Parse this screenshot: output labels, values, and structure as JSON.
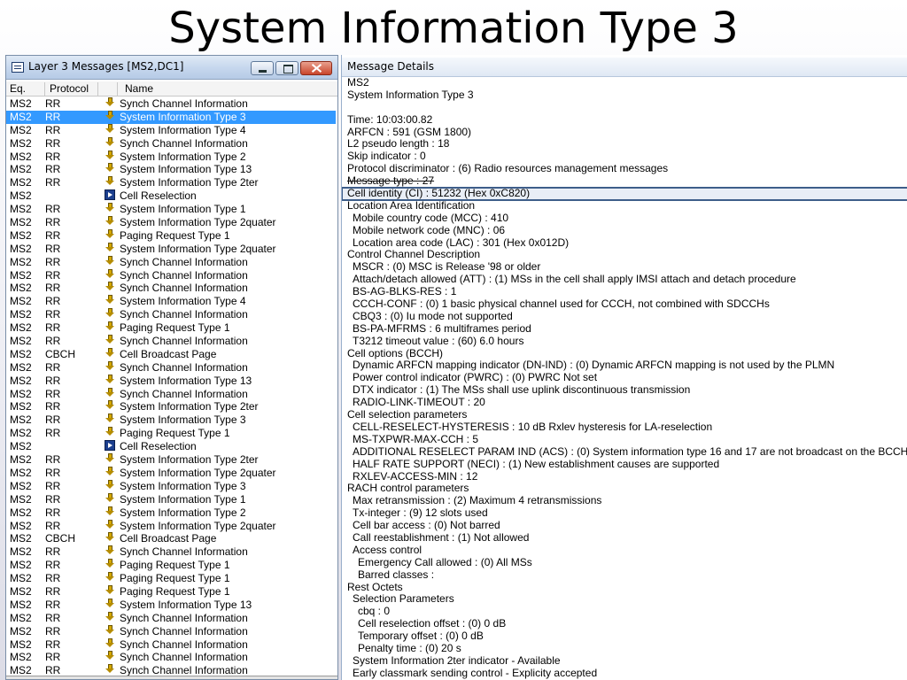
{
  "slide": {
    "title": "System Information Type 3"
  },
  "left_window": {
    "title": "Layer 3 Messages  [MS2,DC1]",
    "columns": {
      "eq": "Eq.",
      "protocol": "Protocol",
      "name": "Name"
    },
    "selected_index": 1,
    "rows": [
      {
        "eq": "MS2",
        "protocol": "RR",
        "icon": "arrow-down",
        "name": "Synch Channel Information"
      },
      {
        "eq": "MS2",
        "protocol": "RR",
        "icon": "arrow-down",
        "name": "System Information Type 3"
      },
      {
        "eq": "MS2",
        "protocol": "RR",
        "icon": "arrow-down",
        "name": "System Information Type 4"
      },
      {
        "eq": "MS2",
        "protocol": "RR",
        "icon": "arrow-down",
        "name": "Synch Channel Information"
      },
      {
        "eq": "MS2",
        "protocol": "RR",
        "icon": "arrow-down",
        "name": "System Information Type 2"
      },
      {
        "eq": "MS2",
        "protocol": "RR",
        "icon": "arrow-down",
        "name": "System Information Type 13"
      },
      {
        "eq": "MS2",
        "protocol": "RR",
        "icon": "arrow-down",
        "name": "System Information Type 2ter"
      },
      {
        "eq": "MS2",
        "protocol": "",
        "icon": "arrow-right",
        "name": "Cell Reselection"
      },
      {
        "eq": "MS2",
        "protocol": "RR",
        "icon": "arrow-down",
        "name": "System Information Type 1"
      },
      {
        "eq": "MS2",
        "protocol": "RR",
        "icon": "arrow-down",
        "name": "System Information Type 2quater"
      },
      {
        "eq": "MS2",
        "protocol": "RR",
        "icon": "arrow-down",
        "name": "Paging Request Type 1"
      },
      {
        "eq": "MS2",
        "protocol": "RR",
        "icon": "arrow-down",
        "name": "System Information Type 2quater"
      },
      {
        "eq": "MS2",
        "protocol": "RR",
        "icon": "arrow-down",
        "name": "Synch Channel Information"
      },
      {
        "eq": "MS2",
        "protocol": "RR",
        "icon": "arrow-down",
        "name": "Synch Channel Information"
      },
      {
        "eq": "MS2",
        "protocol": "RR",
        "icon": "arrow-down",
        "name": "Synch Channel Information"
      },
      {
        "eq": "MS2",
        "protocol": "RR",
        "icon": "arrow-down",
        "name": "System Information Type 4"
      },
      {
        "eq": "MS2",
        "protocol": "RR",
        "icon": "arrow-down",
        "name": "Synch Channel Information"
      },
      {
        "eq": "MS2",
        "protocol": "RR",
        "icon": "arrow-down",
        "name": "Paging Request Type 1"
      },
      {
        "eq": "MS2",
        "protocol": "RR",
        "icon": "arrow-down",
        "name": "Synch Channel Information"
      },
      {
        "eq": "MS2",
        "protocol": "CBCH",
        "icon": "arrow-down",
        "name": "Cell Broadcast Page"
      },
      {
        "eq": "MS2",
        "protocol": "RR",
        "icon": "arrow-down",
        "name": "Synch Channel Information"
      },
      {
        "eq": "MS2",
        "protocol": "RR",
        "icon": "arrow-down",
        "name": "System Information Type 13"
      },
      {
        "eq": "MS2",
        "protocol": "RR",
        "icon": "arrow-down",
        "name": "Synch Channel Information"
      },
      {
        "eq": "MS2",
        "protocol": "RR",
        "icon": "arrow-down",
        "name": "System Information Type 2ter"
      },
      {
        "eq": "MS2",
        "protocol": "RR",
        "icon": "arrow-down",
        "name": "System Information Type 3"
      },
      {
        "eq": "MS2",
        "protocol": "RR",
        "icon": "arrow-down",
        "name": "Paging Request Type 1"
      },
      {
        "eq": "MS2",
        "protocol": "",
        "icon": "arrow-right",
        "name": "Cell Reselection"
      },
      {
        "eq": "MS2",
        "protocol": "RR",
        "icon": "arrow-down",
        "name": "System Information Type 2ter"
      },
      {
        "eq": "MS2",
        "protocol": "RR",
        "icon": "arrow-down",
        "name": "System Information Type 2quater"
      },
      {
        "eq": "MS2",
        "protocol": "RR",
        "icon": "arrow-down",
        "name": "System Information Type 3"
      },
      {
        "eq": "MS2",
        "protocol": "RR",
        "icon": "arrow-down",
        "name": "System Information Type 1"
      },
      {
        "eq": "MS2",
        "protocol": "RR",
        "icon": "arrow-down",
        "name": "System Information Type 2"
      },
      {
        "eq": "MS2",
        "protocol": "RR",
        "icon": "arrow-down",
        "name": "System Information Type 2quater"
      },
      {
        "eq": "MS2",
        "protocol": "CBCH",
        "icon": "arrow-down",
        "name": "Cell Broadcast Page"
      },
      {
        "eq": "MS2",
        "protocol": "RR",
        "icon": "arrow-down",
        "name": "Synch Channel Information"
      },
      {
        "eq": "MS2",
        "protocol": "RR",
        "icon": "arrow-down",
        "name": "Paging Request Type 1"
      },
      {
        "eq": "MS2",
        "protocol": "RR",
        "icon": "arrow-down",
        "name": "Paging Request Type 1"
      },
      {
        "eq": "MS2",
        "protocol": "RR",
        "icon": "arrow-down",
        "name": "Paging Request Type 1"
      },
      {
        "eq": "MS2",
        "protocol": "RR",
        "icon": "arrow-down",
        "name": "System Information Type 13"
      },
      {
        "eq": "MS2",
        "protocol": "RR",
        "icon": "arrow-down",
        "name": "Synch Channel Information"
      },
      {
        "eq": "MS2",
        "protocol": "RR",
        "icon": "arrow-down",
        "name": "Synch Channel Information"
      },
      {
        "eq": "MS2",
        "protocol": "RR",
        "icon": "arrow-down",
        "name": "Synch Channel Information"
      },
      {
        "eq": "MS2",
        "protocol": "RR",
        "icon": "arrow-down",
        "name": "Synch Channel Information"
      },
      {
        "eq": "MS2",
        "protocol": "RR",
        "icon": "arrow-down",
        "name": "Synch Channel Information"
      }
    ]
  },
  "right_window": {
    "title": "Message Details",
    "highlighted_index": 9,
    "struck_index": 8,
    "lines": [
      {
        "indent": 0,
        "text": "MS2"
      },
      {
        "indent": 0,
        "text": "System Information Type 3"
      },
      {
        "indent": 0,
        "text": ""
      },
      {
        "indent": 0,
        "text": "Time: 10:03:00.82"
      },
      {
        "indent": 0,
        "text": "ARFCN : 591 (GSM 1800)"
      },
      {
        "indent": 0,
        "text": "L2 pseudo length : 18"
      },
      {
        "indent": 0,
        "text": "Skip indicator : 0"
      },
      {
        "indent": 0,
        "text": "Protocol discriminator : (6) Radio resources management messages"
      },
      {
        "indent": 0,
        "text": "Message type : 27"
      },
      {
        "indent": 0,
        "text": "Cell identity (CI) : 51232 (Hex 0xC820)"
      },
      {
        "indent": 0,
        "text": "Location Area Identification"
      },
      {
        "indent": 1,
        "text": "Mobile country code (MCC) : 410"
      },
      {
        "indent": 1,
        "text": "Mobile network code (MNC) : 06"
      },
      {
        "indent": 1,
        "text": "Location area code (LAC) : 301 (Hex 0x012D)"
      },
      {
        "indent": 0,
        "text": "Control Channel Description"
      },
      {
        "indent": 1,
        "text": "MSCR : (0) MSC is Release '98 or older"
      },
      {
        "indent": 1,
        "text": "Attach/detach allowed (ATT) : (1) MSs in the cell shall apply IMSI attach and detach procedure"
      },
      {
        "indent": 1,
        "text": "BS-AG-BLKS-RES : 1"
      },
      {
        "indent": 1,
        "text": "CCCH-CONF : (0) 1 basic physical channel used for CCCH, not combined with SDCCHs"
      },
      {
        "indent": 1,
        "text": "CBQ3 : (0) Iu mode not supported"
      },
      {
        "indent": 1,
        "text": "BS-PA-MFRMS : 6 multiframes period"
      },
      {
        "indent": 1,
        "text": "T3212 timeout value : (60) 6.0 hours"
      },
      {
        "indent": 0,
        "text": "Cell options (BCCH)"
      },
      {
        "indent": 1,
        "text": "Dynamic ARFCN mapping indicator (DN-IND) : (0) Dynamic ARFCN mapping is not used by the PLMN"
      },
      {
        "indent": 1,
        "text": "Power control indicator (PWRC) : (0) PWRC Not set"
      },
      {
        "indent": 1,
        "text": "DTX indicator : (1) The MSs shall use uplink discontinuous transmission"
      },
      {
        "indent": 1,
        "text": "RADIO-LINK-TIMEOUT : 20"
      },
      {
        "indent": 0,
        "text": "Cell selection parameters"
      },
      {
        "indent": 1,
        "text": "CELL-RESELECT-HYSTERESIS : 10 dB Rxlev hysteresis for LA-reselection"
      },
      {
        "indent": 1,
        "text": "MS-TXPWR-MAX-CCH : 5"
      },
      {
        "indent": 1,
        "text": "ADDITIONAL RESELECT PARAM IND (ACS) : (0) System information type 16 and 17 are not broadcast on the BCCH"
      },
      {
        "indent": 1,
        "text": "HALF RATE SUPPORT (NECI) : (1) New establishment causes are supported"
      },
      {
        "indent": 1,
        "text": "RXLEV-ACCESS-MIN : 12"
      },
      {
        "indent": 0,
        "text": "RACH control parameters"
      },
      {
        "indent": 1,
        "text": "Max retransmission : (2) Maximum 4 retransmissions"
      },
      {
        "indent": 1,
        "text": "Tx-integer : (9) 12 slots used"
      },
      {
        "indent": 1,
        "text": "Cell bar access : (0) Not barred"
      },
      {
        "indent": 1,
        "text": "Call reestablishment : (1) Not allowed"
      },
      {
        "indent": 1,
        "text": "Access control"
      },
      {
        "indent": 2,
        "text": "Emergency Call allowed : (0) All MSs"
      },
      {
        "indent": 2,
        "text": "Barred classes :"
      },
      {
        "indent": 0,
        "text": "Rest Octets"
      },
      {
        "indent": 1,
        "text": "Selection Parameters"
      },
      {
        "indent": 2,
        "text": "cbq : 0"
      },
      {
        "indent": 2,
        "text": "Cell reselection offset : (0) 0 dB"
      },
      {
        "indent": 2,
        "text": "Temporary offset : (0) 0 dB"
      },
      {
        "indent": 2,
        "text": "Penalty time : (0) 20 s"
      },
      {
        "indent": 1,
        "text": "System Information 2ter indicator - Available"
      },
      {
        "indent": 1,
        "text": "Early classmark sending control - Explicity accepted"
      }
    ]
  }
}
